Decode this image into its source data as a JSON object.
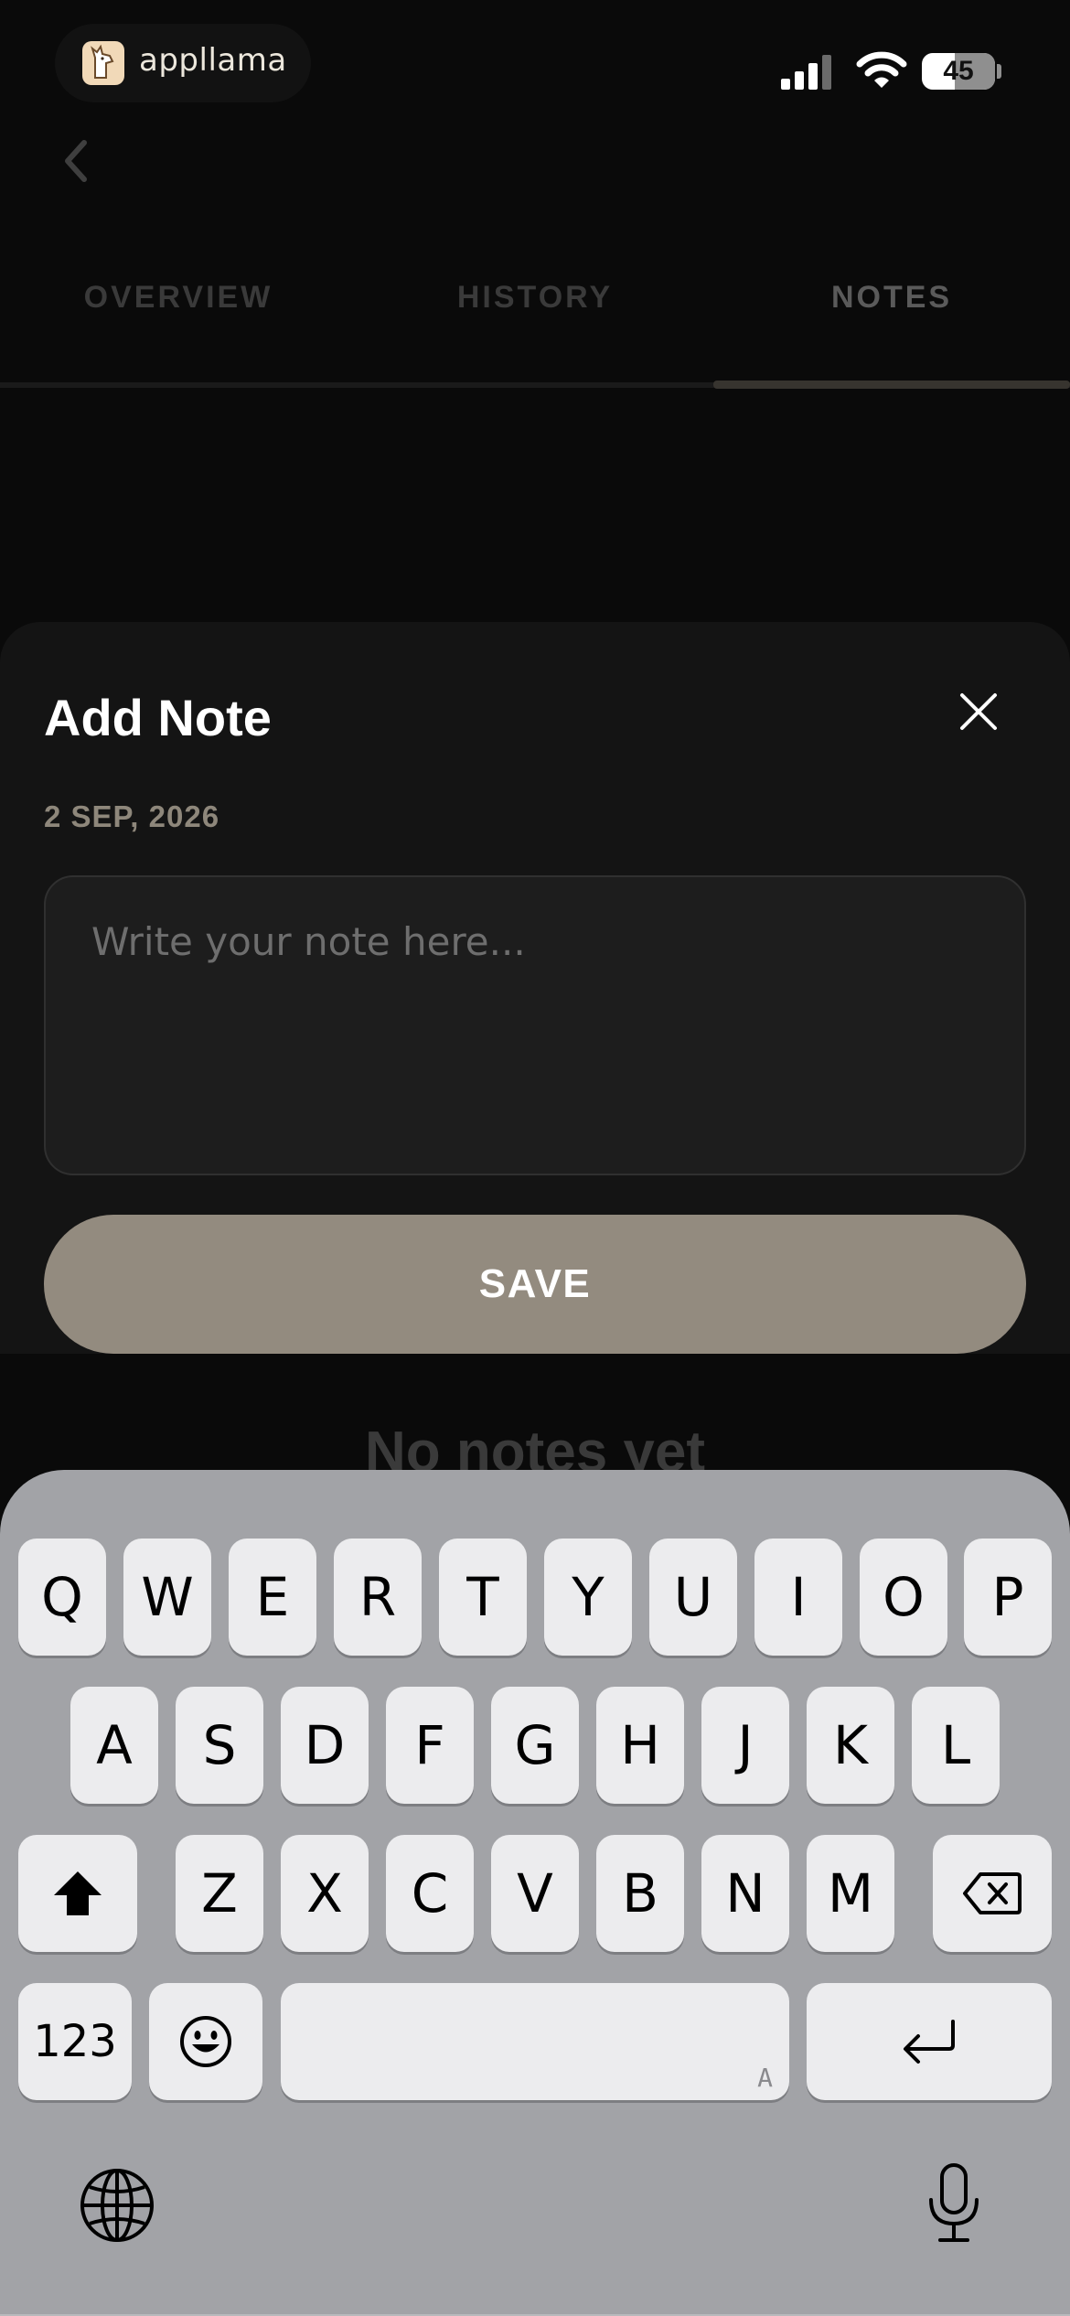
{
  "status_bar": {
    "app_name": "appllama",
    "battery": "45"
  },
  "tabs": [
    {
      "label": "OVERVIEW"
    },
    {
      "label": "HISTORY"
    },
    {
      "label": "NOTES",
      "active": true
    }
  ],
  "sheet": {
    "title": "Add Note",
    "date": "2 SEP, 2026",
    "placeholder": "Write your note here...",
    "save_label": "SAVE"
  },
  "empty_state": "No notes yet",
  "keyboard": {
    "row1": [
      "Q",
      "W",
      "E",
      "R",
      "T",
      "Y",
      "U",
      "I",
      "O",
      "P"
    ],
    "row2": [
      "A",
      "S",
      "D",
      "F",
      "G",
      "H",
      "J",
      "K",
      "L"
    ],
    "row3": [
      "Z",
      "X",
      "C",
      "V",
      "B",
      "N",
      "M"
    ],
    "numbers_label": "123",
    "space_hint": "A"
  },
  "colors": {
    "accent": "#938b7f",
    "date_text": "#8e877b",
    "keyboard_bg": "#a2a3a7",
    "key_bg": "#ececee"
  }
}
